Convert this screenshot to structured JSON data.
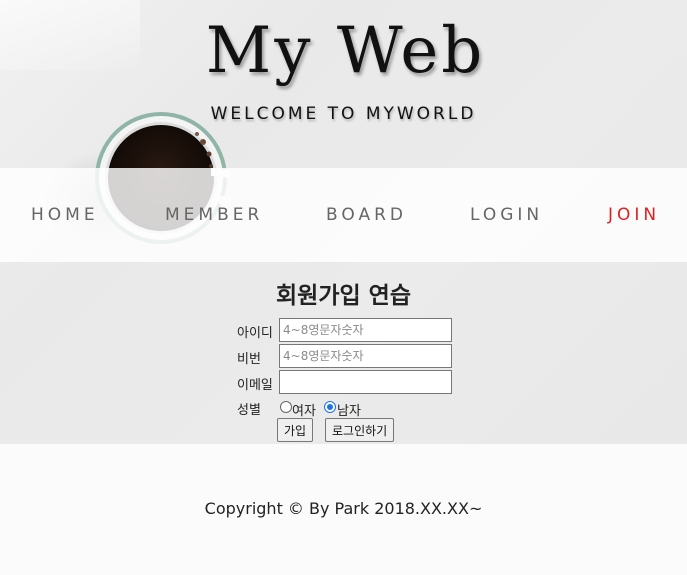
{
  "header": {
    "title": "My Web",
    "subtitle": "WELCOME TO MYWORLD"
  },
  "nav": {
    "items": [
      {
        "label": "HOME"
      },
      {
        "label": "MEMBER"
      },
      {
        "label": "BOARD"
      },
      {
        "label": "LOGIN"
      },
      {
        "label": "JOIN"
      }
    ],
    "active_color": "#e02020"
  },
  "form": {
    "title": "회원가입 연습",
    "id_label": "아이디",
    "id_placeholder": "4~8영문자숫자",
    "id_value": "",
    "pw_label": "비번",
    "pw_placeholder": "4~8영문자숫자",
    "pw_value": "",
    "email_label": "이메일",
    "email_value": "",
    "gender_label": "성별",
    "gender_options": [
      {
        "label": "여자",
        "checked": false
      },
      {
        "label": "남자",
        "checked": true
      }
    ],
    "submit_label": "가입",
    "login_label": "로그인하기"
  },
  "footer": {
    "copyright": "Copyright © By Park 2018.XX.XX~"
  },
  "icons": {
    "background_image": "coffee-mug-image"
  }
}
